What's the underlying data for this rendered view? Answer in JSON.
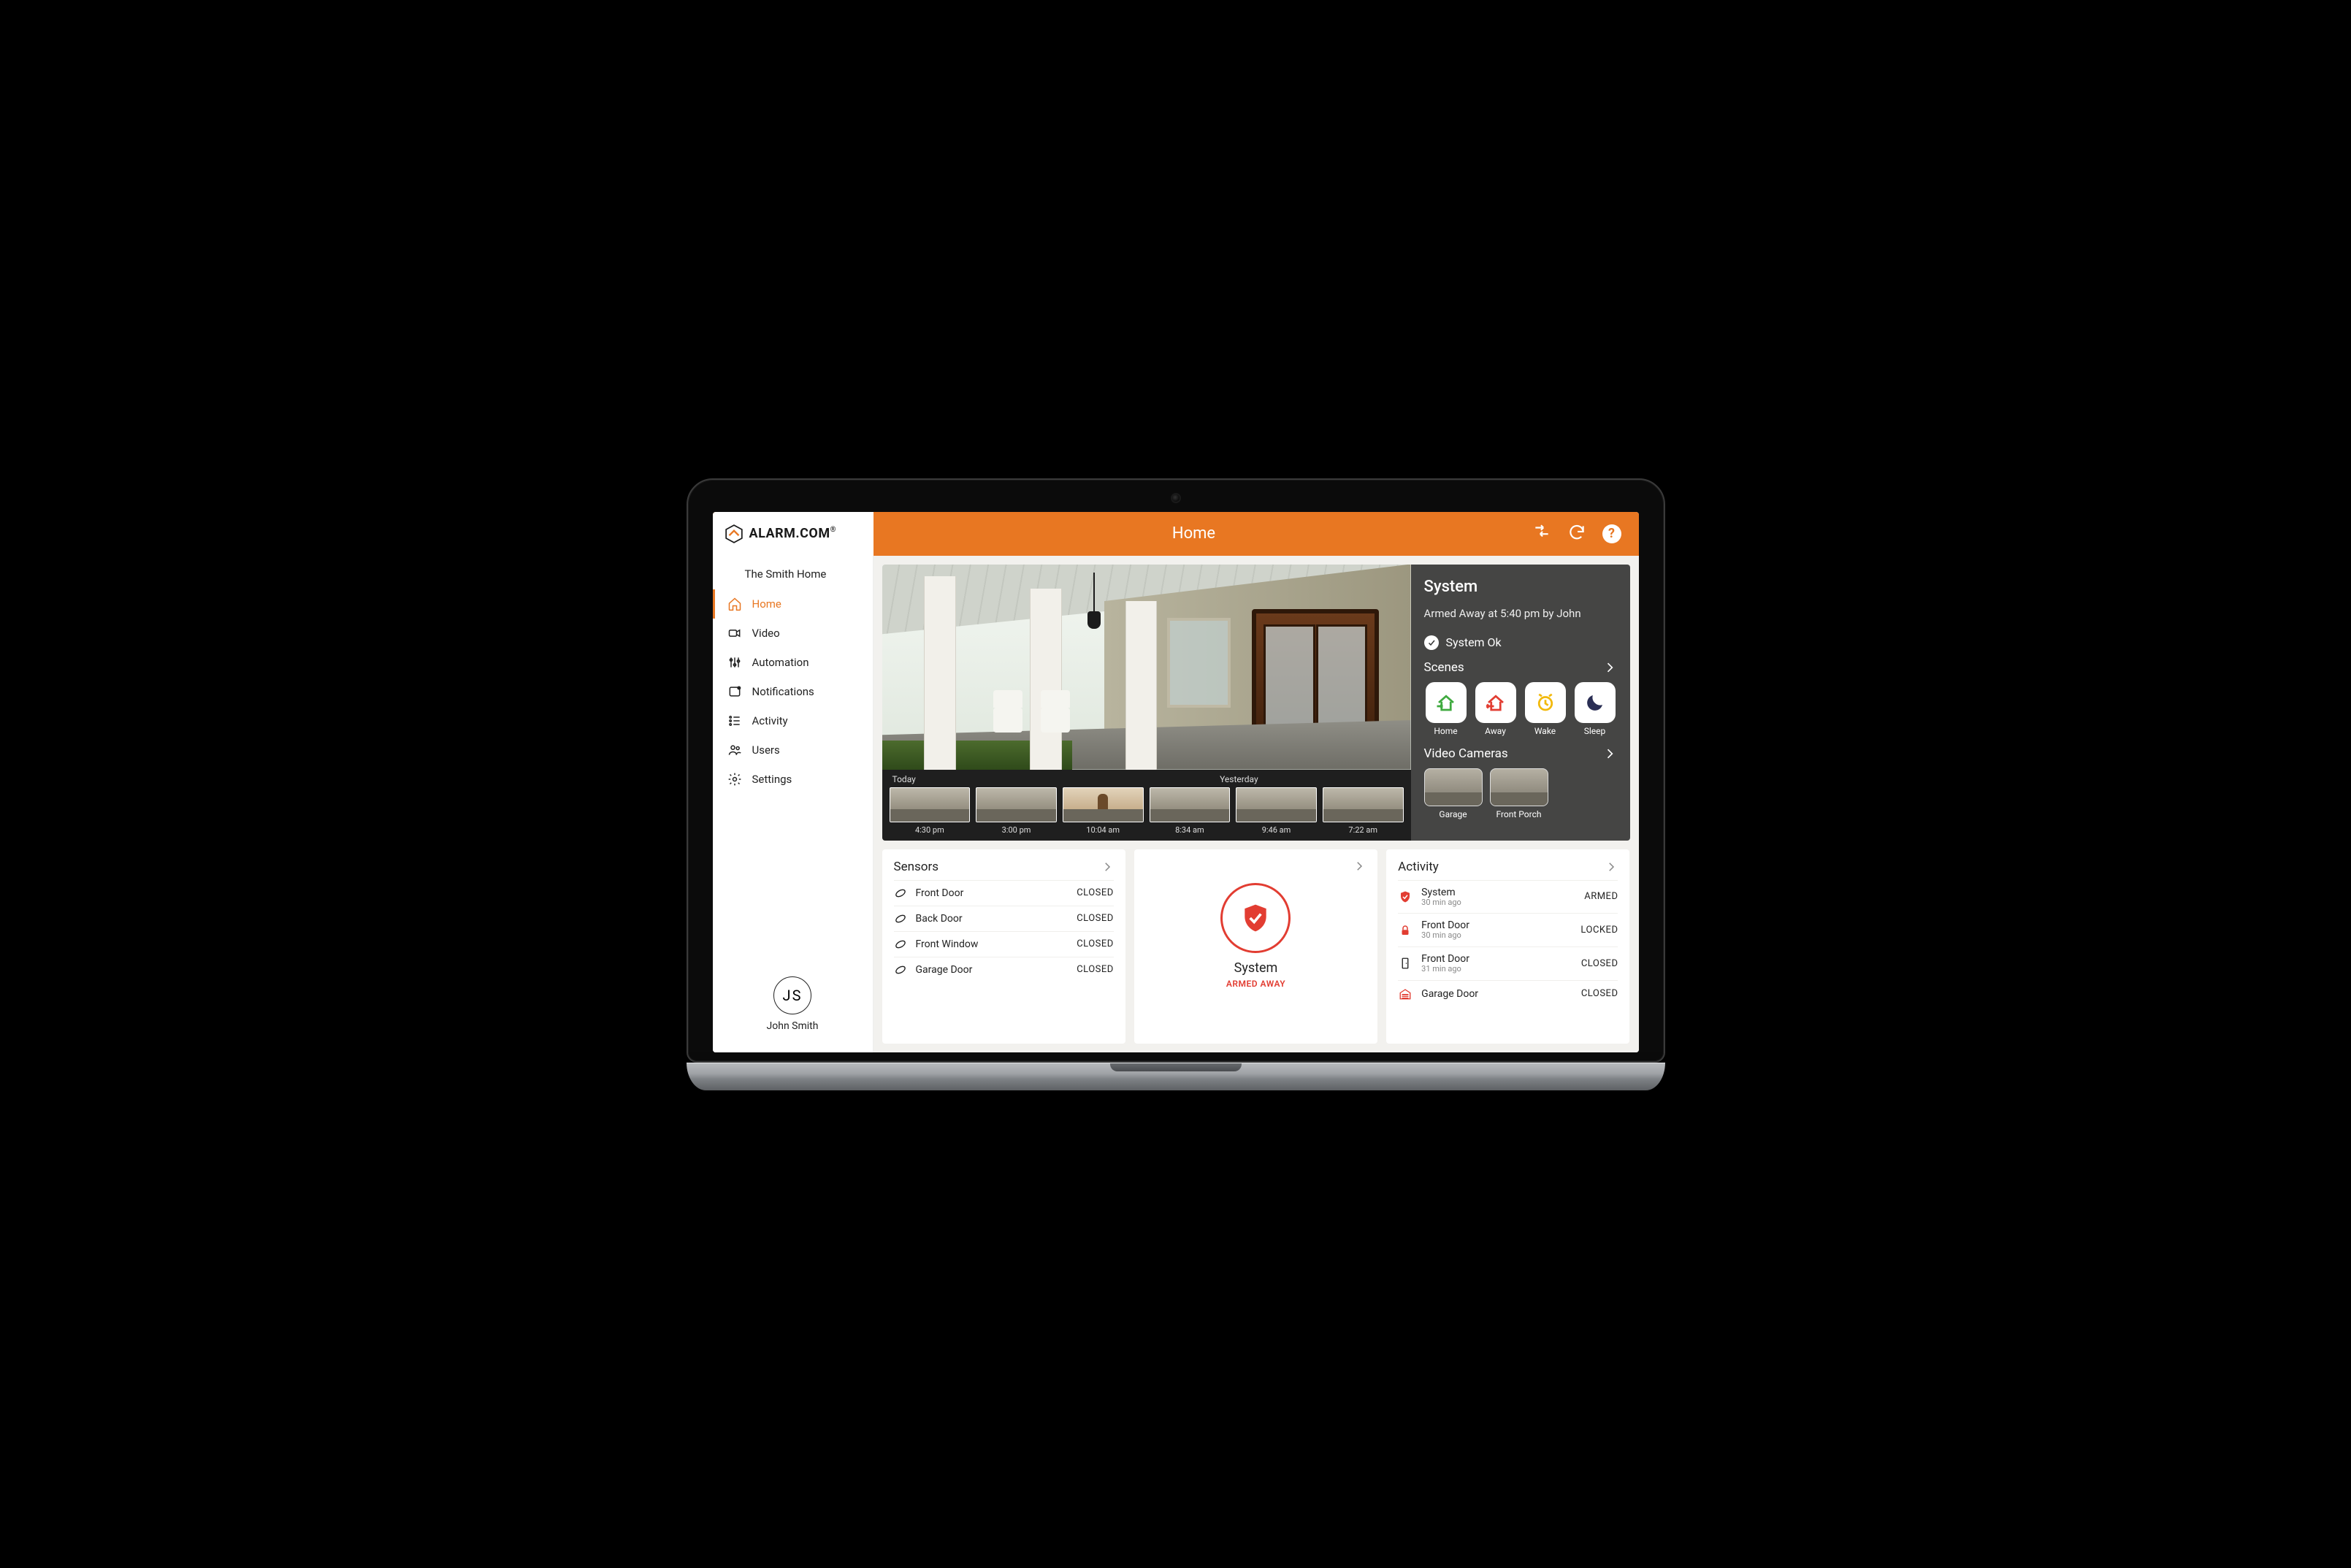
{
  "colors": {
    "brand_orange": "#e87722",
    "alert_red": "#e23d32",
    "scene_home_green": "#3faa3f",
    "scene_away_red": "#e23d32",
    "scene_wake_yellow": "#f2b90c",
    "scene_sleep_navy": "#2a2e54"
  },
  "header": {
    "logo": "ALARM",
    "logo_tld": "COM",
    "title": "Home"
  },
  "sidebar": {
    "home_name": "The Smith Home",
    "items": [
      {
        "icon": "home-icon",
        "label": "Home",
        "active": true
      },
      {
        "icon": "video-icon",
        "label": "Video",
        "active": false
      },
      {
        "icon": "automation-icon",
        "label": "Automation",
        "active": false
      },
      {
        "icon": "notifications-icon",
        "label": "Notifications",
        "active": false
      },
      {
        "icon": "activity-icon",
        "label": "Activity",
        "active": false
      },
      {
        "icon": "users-icon",
        "label": "Users",
        "active": false
      },
      {
        "icon": "settings-icon",
        "label": "Settings",
        "active": false
      }
    ],
    "profile": {
      "initials": "JS",
      "name": "John Smith"
    }
  },
  "hero": {
    "system": {
      "title": "System",
      "status_line": "Armed Away at 5:40 pm by John",
      "ok_label": "System Ok"
    },
    "scenes_label": "Scenes",
    "scenes": [
      {
        "icon": "scene-home-icon",
        "color_key": "scene_home_green",
        "label": "Home"
      },
      {
        "icon": "scene-away-icon",
        "color_key": "scene_away_red",
        "label": "Away"
      },
      {
        "icon": "scene-wake-icon",
        "color_key": "scene_wake_yellow",
        "label": "Wake"
      },
      {
        "icon": "scene-sleep-icon",
        "color_key": "scene_sleep_navy",
        "label": "Sleep"
      }
    ],
    "cameras_label": "Video Cameras",
    "cameras": [
      {
        "label": "Garage"
      },
      {
        "label": "Front Porch"
      }
    ],
    "clips": {
      "today_label": "Today",
      "yesterday_label": "Yesterday",
      "items": [
        {
          "time": "4:30 pm",
          "group": "today"
        },
        {
          "time": "3:00 pm",
          "group": "today"
        },
        {
          "time": "10:04 am",
          "group": "today",
          "person": true
        },
        {
          "time": "8:34 am",
          "group": "today"
        },
        {
          "time": "9:46 am",
          "group": "yesterday"
        },
        {
          "time": "7:22 am",
          "group": "yesterday"
        }
      ]
    }
  },
  "cards": {
    "sensors": {
      "title": "Sensors",
      "rows": [
        {
          "label": "Front Door",
          "status": "CLOSED"
        },
        {
          "label": "Back Door",
          "status": "CLOSED"
        },
        {
          "label": "Front Window",
          "status": "CLOSED"
        },
        {
          "label": "Garage Door",
          "status": "CLOSED"
        }
      ]
    },
    "system": {
      "title": "",
      "label": "System",
      "state": "ARMED AWAY"
    },
    "activity": {
      "title": "Activity",
      "rows": [
        {
          "icon": "shield-icon",
          "icon_color": "alert_red",
          "label": "System",
          "sub": "30 min ago",
          "status": "ARMED"
        },
        {
          "icon": "lock-icon",
          "icon_color": "alert_red",
          "label": "Front Door",
          "sub": "30 min ago",
          "status": "LOCKED"
        },
        {
          "icon": "door-icon",
          "icon_color": "dark",
          "label": "Front Door",
          "sub": "31 min ago",
          "status": "CLOSED"
        },
        {
          "icon": "garage-icon",
          "icon_color": "alert_red",
          "label": "Garage Door",
          "sub": "",
          "status": "CLOSED"
        }
      ]
    }
  }
}
